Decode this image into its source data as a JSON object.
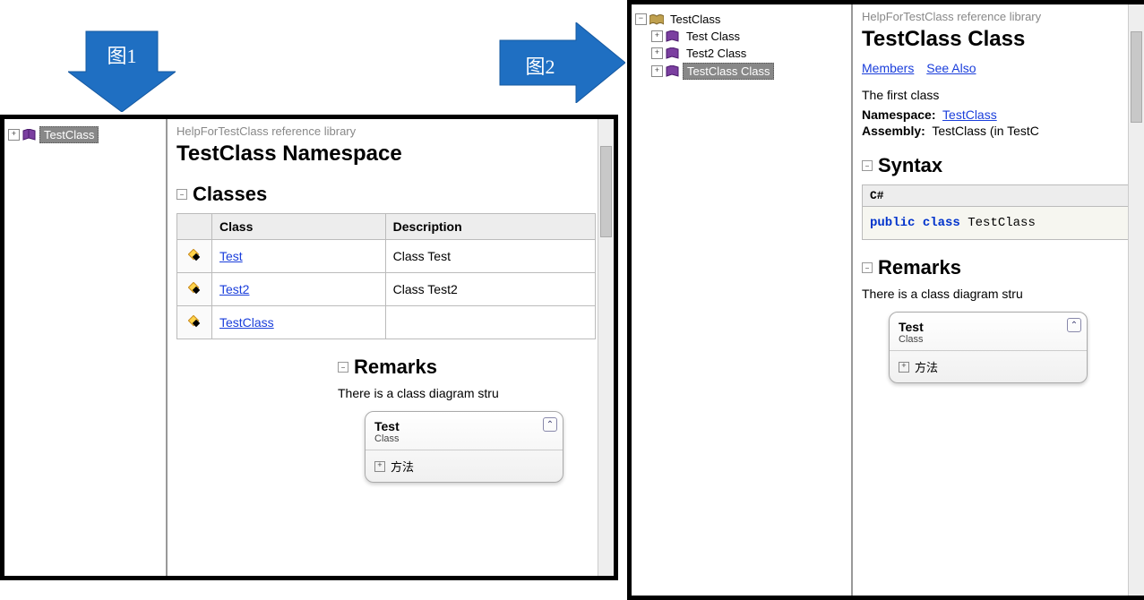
{
  "arrows": {
    "left_label": "图1",
    "right_label": "图2"
  },
  "left": {
    "tree": {
      "root": "TestClass"
    },
    "breadcrumb": "HelpForTestClass reference library",
    "title": "TestClass Namespace",
    "section_classes": "Classes",
    "table": {
      "headers": {
        "class": "Class",
        "description": "Description"
      },
      "rows": [
        {
          "name": "Test",
          "desc": "Class Test"
        },
        {
          "name": "Test2",
          "desc": "Class Test2"
        },
        {
          "name": "TestClass",
          "desc": ""
        }
      ]
    },
    "remarks_head": "Remarks",
    "remarks_text": "There is a class diagram stru",
    "diagram": {
      "title": "Test",
      "subtitle": "Class",
      "methods_label": "方法"
    }
  },
  "right": {
    "tree": {
      "root": "TestClass",
      "children": [
        "Test Class",
        "Test2 Class",
        "TestClass Class"
      ]
    },
    "breadcrumb": "HelpForTestClass reference library",
    "title": "TestClass Class",
    "links": {
      "members": "Members",
      "see_also": "See Also"
    },
    "summary": "The first class",
    "meta": {
      "namespace_label": "Namespace:",
      "namespace_value": "TestClass",
      "assembly_label": "Assembly:",
      "assembly_value": "TestClass (in TestC"
    },
    "syntax_head": "Syntax",
    "syntax_tab": "C#",
    "syntax_code": {
      "kw1": "public",
      "kw2": "class",
      "name": "TestClass"
    },
    "remarks_head": "Remarks",
    "remarks_text": "There is a class diagram stru",
    "diagram": {
      "title": "Test",
      "subtitle": "Class",
      "methods_label": "方法"
    }
  }
}
